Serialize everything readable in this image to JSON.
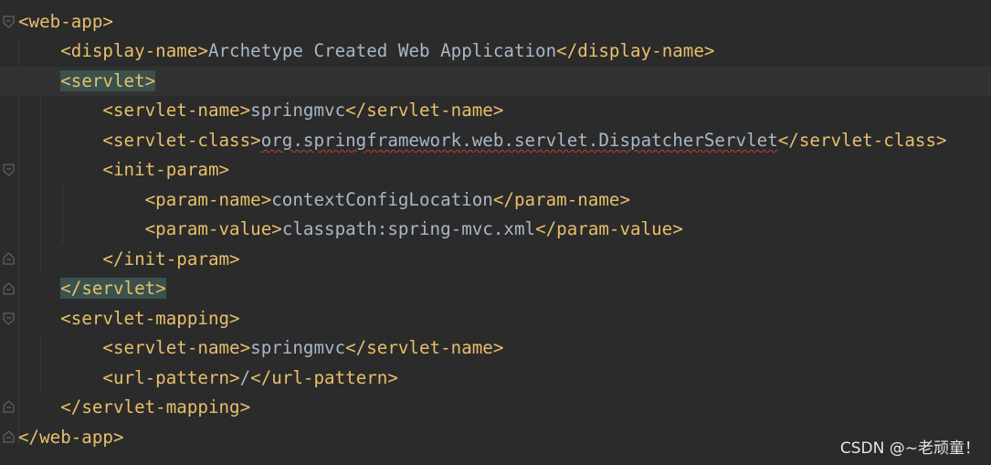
{
  "lines": [
    {
      "open": "<web-app>"
    },
    {
      "open": "<display-name>",
      "text": "Archetype Created Web Application",
      "close": "</display-name>"
    },
    {
      "open": "<servlet>"
    },
    {
      "open": "<servlet-name>",
      "text": "springmvc",
      "close": "</servlet-name>"
    },
    {
      "open": "<servlet-class>",
      "text": "org.springframework.web.servlet.DispatcherServlet",
      "close": "</servlet-class>"
    },
    {
      "open": "<init-param>"
    },
    {
      "open": "<param-name>",
      "text": "contextConfigLocation",
      "close": "</param-name>"
    },
    {
      "open": "<param-value>",
      "text": "classpath:spring-mvc.xml",
      "close": "</param-value>"
    },
    {
      "open": "</init-param>"
    },
    {
      "open": "</servlet>"
    },
    {
      "open": "<servlet-mapping>"
    },
    {
      "open": "<servlet-name>",
      "text": "springmvc",
      "close": "</servlet-name>"
    },
    {
      "open": "<url-pattern>",
      "text": "/",
      "close": "</url-pattern>"
    },
    {
      "open": "</servlet-mapping>"
    },
    {
      "open": "</web-app>"
    }
  ],
  "watermark": "CSDN @~老顽童！",
  "colors": {
    "background": "#2b2b2b",
    "tag": "#e8bf6a",
    "text": "#a9b7c6",
    "matched_tag_highlight": "#3b514d",
    "current_line": "#323232",
    "spell_error": "#bc3f3c"
  },
  "icons": {
    "fold_open": "fold-open-icon",
    "fold_close": "fold-close-icon"
  }
}
